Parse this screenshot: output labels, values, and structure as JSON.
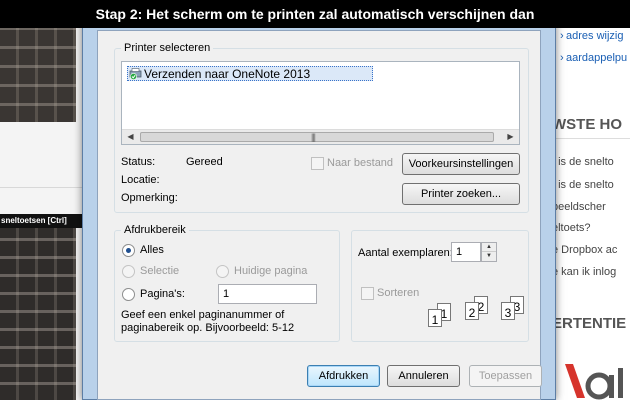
{
  "banner": {
    "text": "Stap 2: Het scherm om te printen zal automatisch verschijnen dan"
  },
  "background": {
    "keyboard_caption": "sneltoetsen [Ctrl]",
    "right_links": [
      "adres wijzig",
      "aardappelpu"
    ],
    "right_heading_1": "WSTE HO",
    "right_items": [
      "t is de snelto",
      "t is de snelto",
      "beeldscher",
      "eltoets?",
      "e Dropbox ac",
      "e kan ik inlog"
    ],
    "right_heading_2": "ERTENTIE",
    "colors": {
      "link": "#1a5fb4",
      "logo_red": "#d6342c"
    }
  },
  "dialog": {
    "printer_group": {
      "title": "Printer selecteren",
      "printers": [
        {
          "name": "Verzenden naar OneNote 2013",
          "selected": true
        }
      ],
      "status_label": "Status:",
      "status_value": "Gereed",
      "location_label": "Locatie:",
      "location_value": "",
      "comment_label": "Opmerking:",
      "comment_value": "",
      "print_to_file_label": "Naar bestand",
      "preferences_button": "Voorkeursinstellingen",
      "find_printer_button": "Printer zoeken..."
    },
    "range_group": {
      "title": "Afdrukbereik",
      "all_label": "Alles",
      "selection_label": "Selectie",
      "current_page_label": "Huidige pagina",
      "pages_label": "Pagina's:",
      "pages_value": "1",
      "hint": "Geef een enkel paginanummer of paginabereik op. Bijvoorbeeld: 5-12"
    },
    "copies_group": {
      "copies_label": "Aantal exemplaren:",
      "copies_value": "1",
      "collate_label": "Sorteren",
      "collate_pages": [
        "1",
        "1",
        "2",
        "2",
        "3",
        "3"
      ]
    },
    "buttons": {
      "print": "Afdrukken",
      "cancel": "Annuleren",
      "apply": "Toepassen"
    }
  }
}
